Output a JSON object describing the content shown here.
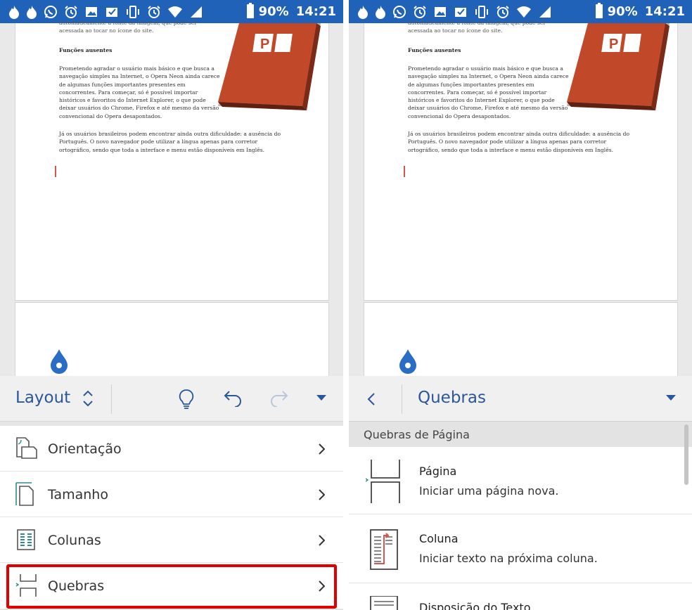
{
  "status_bar": {
    "battery": "90%",
    "time": "14:21",
    "icons": [
      "flame-icon",
      "flame-icon",
      "whatsapp-icon",
      "alarm-icon",
      "image-icon",
      "checkbox-image-icon",
      "vibrate-icon",
      "alarm-icon",
      "wifi-icon",
      "signal-icon"
    ]
  },
  "document": {
    "top_text": "automaticamente a fonte da imagem, que pode ser acessada ao tocar no ícone do site.",
    "heading": "Funções ausentes",
    "para1": "Prometendo agradar o usuário mais básico e que busca a navegação simples na Internet, o Opera Neon ainda carece de algumas funções importantes presentes em concorrentes. Para começar, só é possível importar históricos e favoritos do Internet Explorer, o que pode deixar usuários do Chrome, Firefox e até mesmo da versão convencional do Opera desapontados.",
    "para2": "Já os usuários brasileiros podem encontrar ainda outra dificuldade: a ausência do Português. O novo navegador pode utilizar a língua apenas para corretor ortográfico, sendo que toda a interface e menu estão disponíveis em Inglês.",
    "book_colors": {
      "cover": "#c1492a",
      "logo": "#ffffff"
    }
  },
  "left": {
    "toolbar": {
      "title": "Layout"
    },
    "menu": [
      {
        "label": "Orientação",
        "icon": "orientation-icon"
      },
      {
        "label": "Tamanho",
        "icon": "page-size-icon"
      },
      {
        "label": "Colunas",
        "icon": "columns-icon"
      },
      {
        "label": "Quebras",
        "icon": "breaks-icon"
      }
    ],
    "highlight_color": "#e10000"
  },
  "right": {
    "toolbar": {
      "title": "Quebras"
    },
    "section": "Quebras de Página",
    "items": [
      {
        "title": "Página",
        "desc": "Iniciar uma página nova.",
        "icon": "page-break-icon"
      },
      {
        "title": "Coluna",
        "desc": "Iniciar texto na próxima coluna.",
        "icon": "column-break-icon"
      },
      {
        "title": "Disposição do Texto",
        "desc": "",
        "icon": "text-wrap-icon"
      }
    ]
  },
  "colors": {
    "accent": "#2b579a",
    "status_bar": "#1f62b8"
  }
}
